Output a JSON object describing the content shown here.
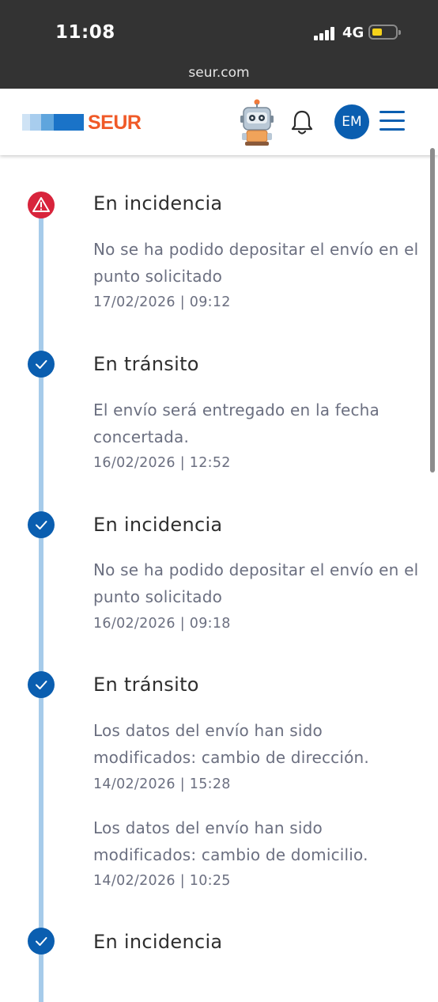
{
  "status_bar": {
    "time": "11:08",
    "network": "4G",
    "url": "seur.com"
  },
  "header": {
    "logo_text": "SEUR",
    "avatar_initials": "EM",
    "colors": {
      "brand_blue": "#0a5eb0",
      "brand_orange": "#f05a28"
    },
    "icons": [
      "robot-assistant-icon",
      "bell-icon",
      "hamburger-menu-icon"
    ]
  },
  "timeline": {
    "line_color": "#a6cbea",
    "events": [
      {
        "status": "En incidencia",
        "icon": "alert-icon",
        "entries": [
          {
            "text": "No se ha podido depositar el envío en el punto solicitado",
            "date": "17/02/2026 | 09:12"
          }
        ]
      },
      {
        "status": "En tránsito",
        "icon": "check-icon",
        "entries": [
          {
            "text": "El envío será entregado en la fecha concertada.",
            "date": "16/02/2026 | 12:52"
          }
        ]
      },
      {
        "status": "En incidencia",
        "icon": "check-icon",
        "entries": [
          {
            "text": "No se ha podido depositar el envío en el punto solicitado",
            "date": "16/02/2026 | 09:18"
          }
        ]
      },
      {
        "status": "En tránsito",
        "icon": "check-icon",
        "entries": [
          {
            "text": "Los datos del envío han sido modificados: cambio de dirección.",
            "date": "14/02/2026 | 15:28"
          },
          {
            "text": "Los datos del envío han sido modificados: cambio de domicilio.",
            "date": "14/02/2026 | 10:25"
          }
        ]
      },
      {
        "status": "En incidencia",
        "icon": "check-icon",
        "entries": []
      }
    ]
  }
}
